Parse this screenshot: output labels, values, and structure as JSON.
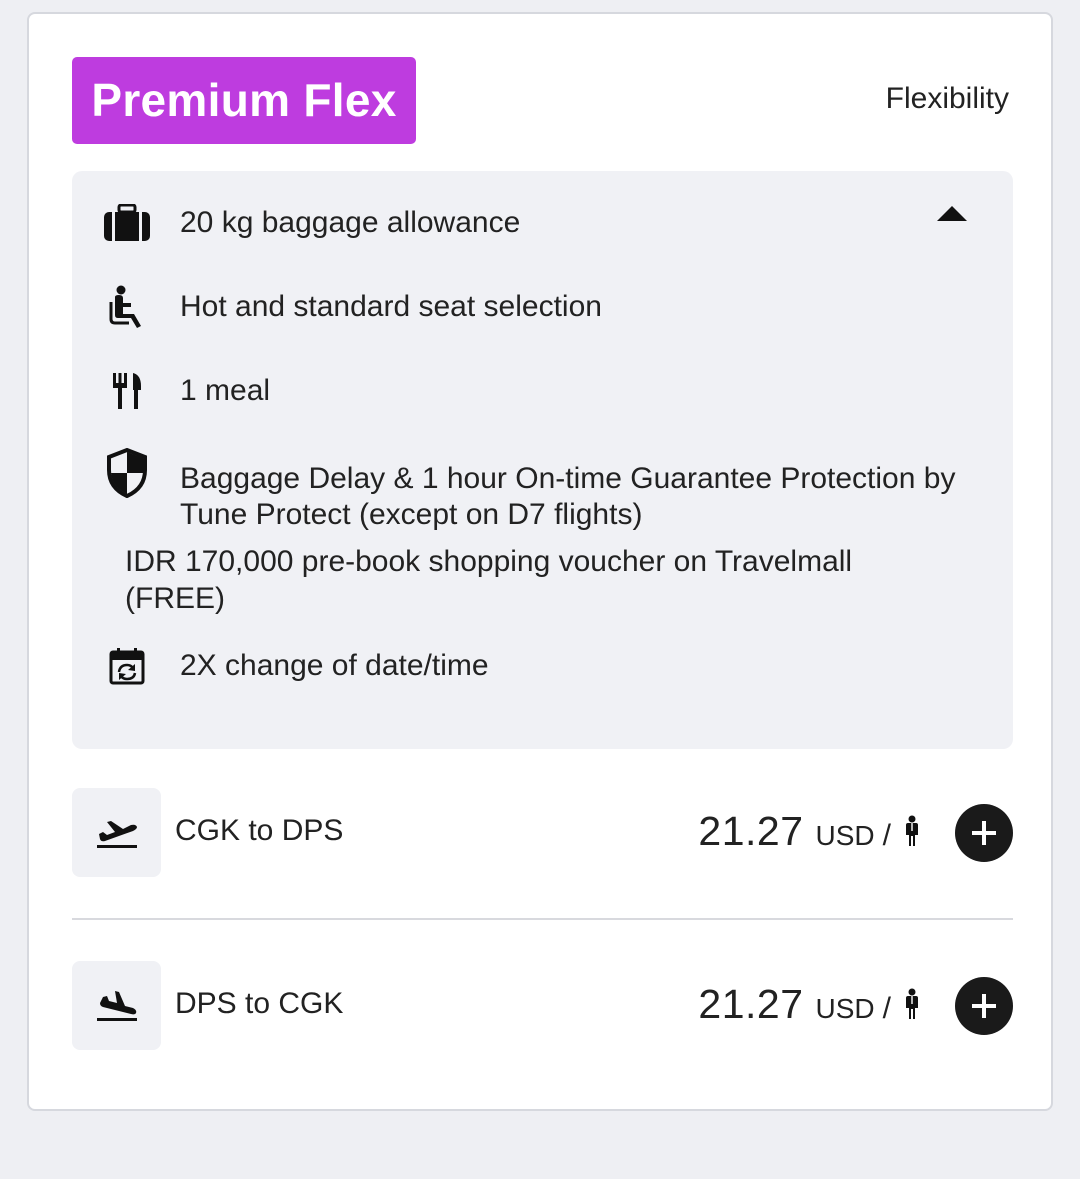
{
  "fare": {
    "name": "Premium Flex",
    "badge_color": "#be3cdf",
    "subtitle": "Flexibility"
  },
  "benefits": {
    "items": [
      {
        "icon": "luggage-icon",
        "label": "20 kg baggage allowance"
      },
      {
        "icon": "seat-icon",
        "label": "Hot and standard seat selection"
      },
      {
        "icon": "meal-icon",
        "label": "1 meal"
      },
      {
        "icon": "shield-icon",
        "label": "Baggage Delay & 1 hour On-time Guarantee Protection by Tune Protect (except on D7 flights)"
      },
      {
        "icon": "",
        "label": "IDR 170,000 pre-book shopping voucher on Travelmall (FREE)"
      },
      {
        "icon": "calendar-change-icon",
        "label": "2X change of date/time"
      }
    ],
    "collapse_icon": "caret-up-icon"
  },
  "routes": [
    {
      "icon": "takeoff-icon",
      "label": "CGK to DPS",
      "amount": "21.27",
      "currency": "USD",
      "per": "/"
    },
    {
      "icon": "landing-icon",
      "label": "DPS to CGK",
      "amount": "21.27",
      "currency": "USD",
      "per": "/"
    }
  ]
}
